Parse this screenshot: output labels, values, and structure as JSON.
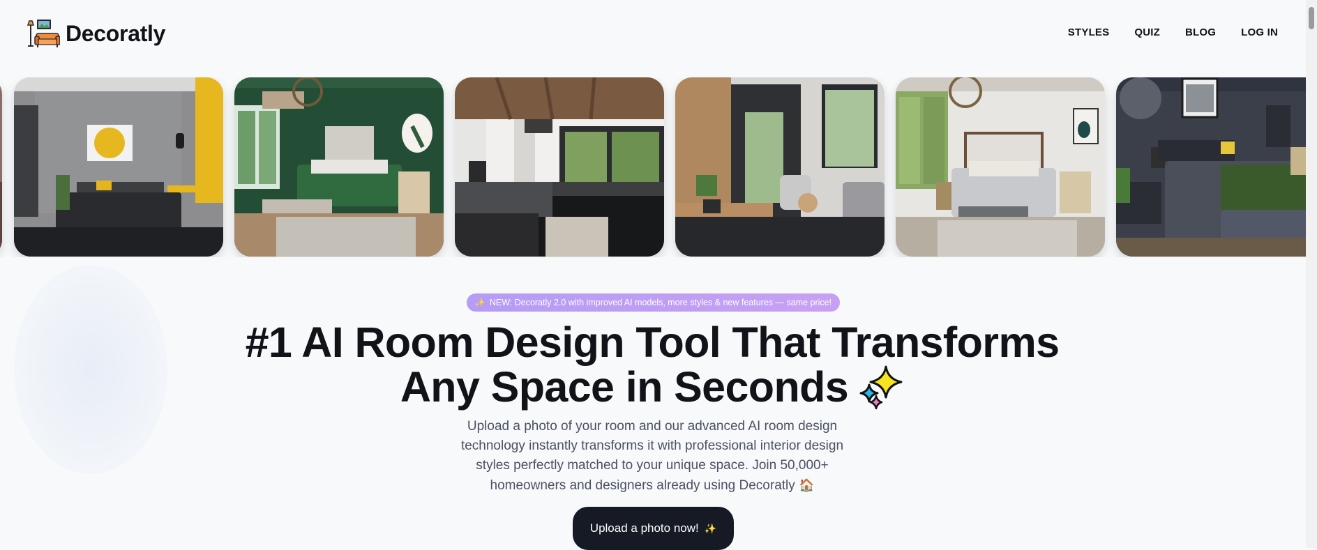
{
  "brand": {
    "name": "Decoratly",
    "logo_icon": "couch-lamp-logo-icon"
  },
  "nav": {
    "items": [
      {
        "label": "STYLES"
      },
      {
        "label": "QUIZ"
      },
      {
        "label": "BLOG"
      },
      {
        "label": "LOG IN"
      }
    ]
  },
  "carousel": {
    "images": [
      {
        "alt": "bedroom-yellow-accent"
      },
      {
        "alt": "bedroom-green-walls"
      },
      {
        "alt": "kitchen-dark-cabinets"
      },
      {
        "alt": "living-room-dark"
      },
      {
        "alt": "bedroom-light-gray"
      },
      {
        "alt": "bedroom-navy-yellow"
      }
    ]
  },
  "hero": {
    "badge_icon": "sparkles-icon",
    "badge_text": "NEW: Decoratly 2.0 with improved AI models, more styles & new features — same price!",
    "headline_line1": "#1 AI Room Design Tool That Transforms",
    "headline_line2": "Any Space in Seconds",
    "headline_icon": "sparkles-icon",
    "subtitle": "Upload a photo of your room and our advanced AI room design technology instantly transforms it with professional interior design styles perfectly matched to your unique space. Join 50,000+ homeowners and designers already using Decoratly",
    "subtitle_icon": "🏠",
    "cta_label": "Upload a photo now!",
    "cta_icon": "✨"
  },
  "colors": {
    "background": "#f7f9fb",
    "text": "#111318",
    "badge": "#b59cf6",
    "cta": "#161a24"
  }
}
